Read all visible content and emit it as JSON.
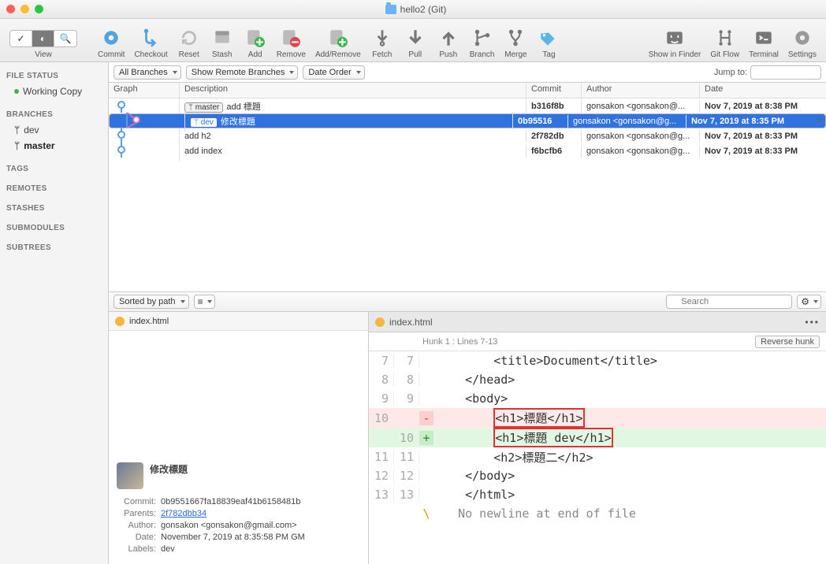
{
  "window": {
    "title": "hello2 (Git)"
  },
  "toolbar": {
    "view": "View",
    "commit": "Commit",
    "checkout": "Checkout",
    "reset": "Reset",
    "stash": "Stash",
    "add": "Add",
    "remove": "Remove",
    "addremove": "Add/Remove",
    "fetch": "Fetch",
    "pull": "Pull",
    "push": "Push",
    "branch": "Branch",
    "merge": "Merge",
    "tag": "Tag",
    "finder": "Show in Finder",
    "gitflow": "Git Flow",
    "terminal": "Terminal",
    "settings": "Settings"
  },
  "filters": {
    "all_branches": "All Branches",
    "remote": "Show Remote Branches",
    "date_order": "Date Order",
    "jump_to_label": "Jump to:"
  },
  "sidebar": {
    "file_status": "FILE STATUS",
    "working_copy": "Working Copy",
    "branches": "BRANCHES",
    "dev": "dev",
    "master": "master",
    "tags": "TAGS",
    "remotes": "REMOTES",
    "stashes": "STASHES",
    "submodules": "SUBMODULES",
    "subtrees": "SUBTREES"
  },
  "table": {
    "headers": {
      "graph": "Graph",
      "desc": "Description",
      "commit": "Commit",
      "author": "Author",
      "date": "Date"
    },
    "rows": [
      {
        "badge": "master",
        "desc": "add 標題",
        "commit": "b316f8b",
        "author": "gonsakon <gonsakon@...",
        "date": "Nov 7, 2019 at 8:38 PM",
        "selected": false
      },
      {
        "badge": "dev",
        "desc": "修改標題",
        "commit": "0b95516",
        "author": "gonsakon <gonsakon@g...",
        "date": "Nov 7, 2019 at 8:35 PM",
        "selected": true
      },
      {
        "badge": "",
        "desc": "add h2",
        "commit": "2f782db",
        "author": "gonsakon <gonsakon@g...",
        "date": "Nov 7, 2019 at 8:33 PM",
        "selected": false
      },
      {
        "badge": "",
        "desc": "add index",
        "commit": "f6bcfb6",
        "author": "gonsakon <gonsakon@g...",
        "date": "Nov 7, 2019 at 8:33 PM",
        "selected": false
      }
    ]
  },
  "bottom_bar": {
    "sorted": "Sorted by path",
    "search_placeholder": "Search"
  },
  "left_pane": {
    "file": "index.html",
    "message": "修改標題",
    "commit_label": "Commit:",
    "commit": "0b9551667fa18839eaf41b6158481b",
    "parents_label": "Parents:",
    "parents": "2f782dbb34",
    "author_label": "Author:",
    "author": "gonsakon <gonsakon@gmail.com>",
    "date_label": "Date:",
    "date": "November 7, 2019 at 8:35:58 PM GM",
    "labels_label": "Labels:",
    "labels": "dev"
  },
  "right_pane": {
    "file": "index.html",
    "hunk": "Hunk 1 : Lines 7-13",
    "reverse": "Reverse hunk",
    "lines": [
      {
        "a": "7",
        "b": "7",
        "s": " ",
        "t": "        <title>Document</title>",
        "cls": ""
      },
      {
        "a": "8",
        "b": "8",
        "s": " ",
        "t": "    </head>",
        "cls": ""
      },
      {
        "a": "9",
        "b": "9",
        "s": " ",
        "t": "    <body>",
        "cls": ""
      },
      {
        "a": "10",
        "b": "",
        "s": "-",
        "t": "        <h1>標題</h1>",
        "cls": "minus",
        "box": true
      },
      {
        "a": "",
        "b": "10",
        "s": "+",
        "t": "        <h1>標題 dev</h1>",
        "cls": "plus",
        "box": true
      },
      {
        "a": "11",
        "b": "11",
        "s": " ",
        "t": "        <h2>標題二</h2>",
        "cls": ""
      },
      {
        "a": "12",
        "b": "12",
        "s": " ",
        "t": "    </body>",
        "cls": ""
      },
      {
        "a": "13",
        "b": "13",
        "s": " ",
        "t": "    </html>",
        "cls": ""
      },
      {
        "a": "",
        "b": "",
        "s": "\\",
        "t": "   No newline at end of file",
        "cls": "nnl"
      }
    ]
  }
}
